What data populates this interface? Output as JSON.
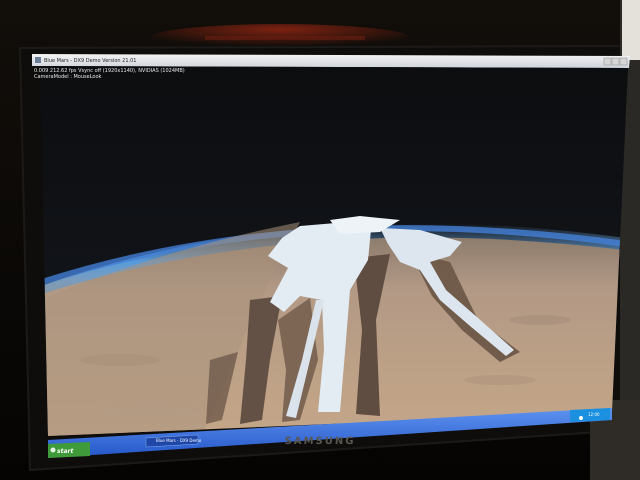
{
  "window": {
    "title": "Blue Mars - DX9 Demo Version 21.01"
  },
  "hud": {
    "line_1": "0.009 212.62 fps Vsync off (1920x1140), NVIDIAS (1024MB)",
    "line_2": "CameraModel : MouseLook"
  },
  "taskbar": {
    "start_label": "start",
    "task_label": "Blue Mars - DX9 Demo",
    "clock": "12:00"
  },
  "monitor": {
    "brand": "SAMSUNG"
  },
  "colors": {
    "bezel": "#0c0b0a",
    "desert": "#b89a7e",
    "water": "#dfe8f0",
    "atmosphere": "#4a8fd8",
    "taskbar": "#2e6de0",
    "start_button": "#3f9a3a"
  },
  "icons": [
    "window-app-icon",
    "minimize-icon",
    "maximize-icon",
    "close-icon",
    "start-flag-icon",
    "tray-icon"
  ]
}
